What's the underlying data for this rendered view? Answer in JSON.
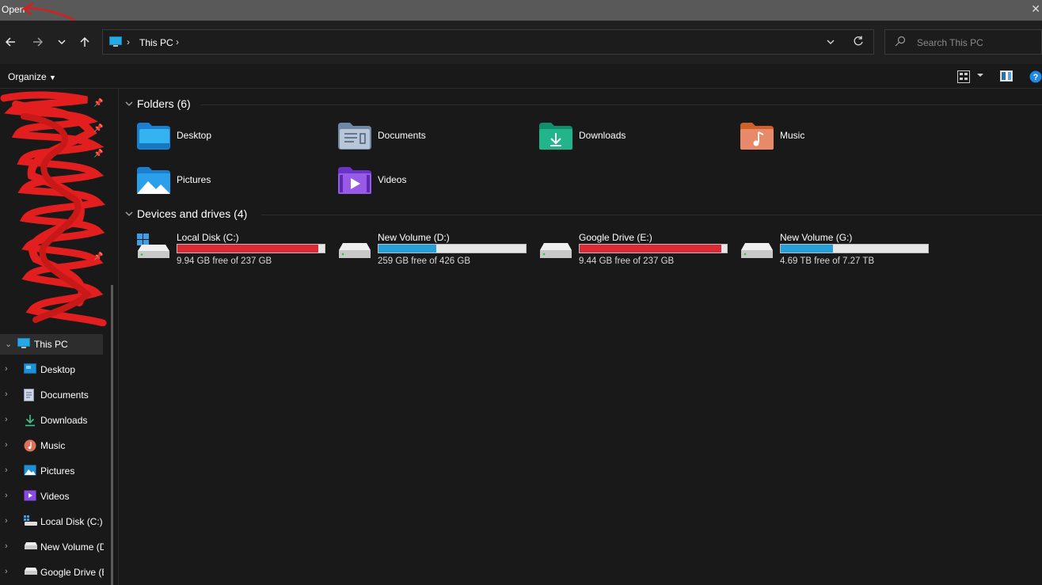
{
  "window": {
    "title": "Open",
    "close_glyph": "✕"
  },
  "address": {
    "crumb": "This PC",
    "sep": "›",
    "dropdown_glyph": "⌄",
    "refresh_glyph": "⟳"
  },
  "search": {
    "placeholder": "Search This PC"
  },
  "command_bar": {
    "organize_label": "Organize"
  },
  "sidebar": {
    "pinned_redacted_count": 8,
    "items": [
      {
        "label": "This PC",
        "icon": "pc-icon"
      },
      {
        "label": "Desktop",
        "icon": "desktop-icon"
      },
      {
        "label": "Documents",
        "icon": "documents-icon"
      },
      {
        "label": "Downloads",
        "icon": "downloads-icon"
      },
      {
        "label": "Music",
        "icon": "music-icon"
      },
      {
        "label": "Pictures",
        "icon": "pictures-icon"
      },
      {
        "label": "Videos",
        "icon": "videos-icon"
      },
      {
        "label": "Local Disk (C:)",
        "icon": "drive-c-icon"
      },
      {
        "label": "New Volume (D:)",
        "icon": "drive-icon"
      },
      {
        "label": "Google Drive (E:)",
        "icon": "drive-icon"
      }
    ]
  },
  "folders": {
    "header": "Folders (6)",
    "items": [
      {
        "label": "Desktop",
        "icon": "desktop-folder-icon"
      },
      {
        "label": "Documents",
        "icon": "documents-folder-icon"
      },
      {
        "label": "Downloads",
        "icon": "downloads-folder-icon"
      },
      {
        "label": "Music",
        "icon": "music-folder-icon"
      },
      {
        "label": "Pictures",
        "icon": "pictures-folder-icon"
      },
      {
        "label": "Videos",
        "icon": "videos-folder-icon"
      }
    ]
  },
  "drives": {
    "header": "Devices and drives (4)",
    "items": [
      {
        "label": "Local Disk (C:)",
        "free": "9.94 GB free of 237 GB",
        "used_fraction": 0.958,
        "bar_color": "#da2a35"
      },
      {
        "label": "New Volume (D:)",
        "free": "259 GB free of 426 GB",
        "used_fraction": 0.392,
        "bar_color": "#26a0da"
      },
      {
        "label": "Google Drive (E:)",
        "free": "9.44 GB free of 237 GB",
        "used_fraction": 0.96,
        "bar_color": "#da2a35"
      },
      {
        "label": "New Volume (G:)",
        "free": "4.69 TB free of 7.27 TB",
        "used_fraction": 0.355,
        "bar_color": "#26a0da"
      }
    ]
  },
  "colors": {
    "accent_blue": "#26a0da",
    "warning_red": "#da2a35",
    "background": "#191919"
  }
}
